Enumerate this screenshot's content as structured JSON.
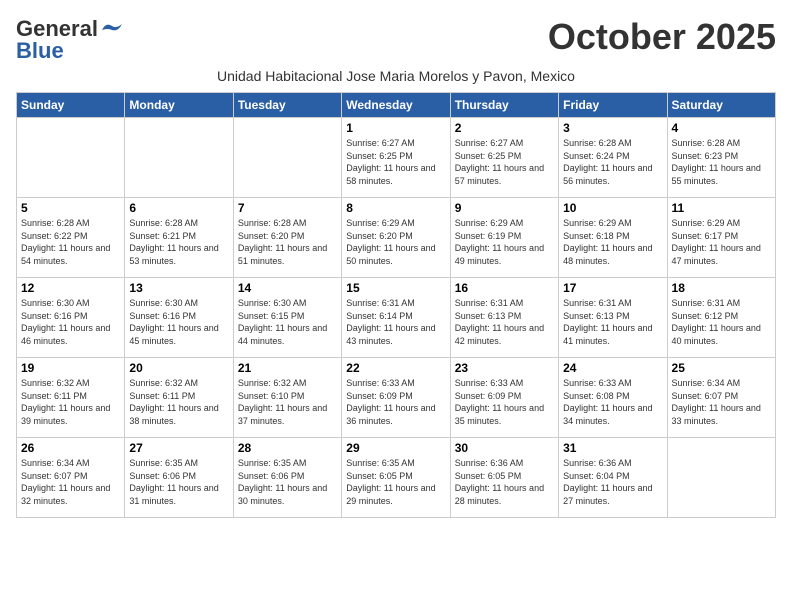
{
  "header": {
    "logo_general": "General",
    "logo_blue": "Blue",
    "month_title": "October 2025",
    "subtitle": "Unidad Habitacional Jose Maria Morelos y Pavon, Mexico"
  },
  "weekdays": [
    "Sunday",
    "Monday",
    "Tuesday",
    "Wednesday",
    "Thursday",
    "Friday",
    "Saturday"
  ],
  "weeks": [
    [
      {
        "day": "",
        "sunrise": "",
        "sunset": "",
        "daylight": ""
      },
      {
        "day": "",
        "sunrise": "",
        "sunset": "",
        "daylight": ""
      },
      {
        "day": "",
        "sunrise": "",
        "sunset": "",
        "daylight": ""
      },
      {
        "day": "1",
        "sunrise": "Sunrise: 6:27 AM",
        "sunset": "Sunset: 6:25 PM",
        "daylight": "Daylight: 11 hours and 58 minutes."
      },
      {
        "day": "2",
        "sunrise": "Sunrise: 6:27 AM",
        "sunset": "Sunset: 6:25 PM",
        "daylight": "Daylight: 11 hours and 57 minutes."
      },
      {
        "day": "3",
        "sunrise": "Sunrise: 6:28 AM",
        "sunset": "Sunset: 6:24 PM",
        "daylight": "Daylight: 11 hours and 56 minutes."
      },
      {
        "day": "4",
        "sunrise": "Sunrise: 6:28 AM",
        "sunset": "Sunset: 6:23 PM",
        "daylight": "Daylight: 11 hours and 55 minutes."
      }
    ],
    [
      {
        "day": "5",
        "sunrise": "Sunrise: 6:28 AM",
        "sunset": "Sunset: 6:22 PM",
        "daylight": "Daylight: 11 hours and 54 minutes."
      },
      {
        "day": "6",
        "sunrise": "Sunrise: 6:28 AM",
        "sunset": "Sunset: 6:21 PM",
        "daylight": "Daylight: 11 hours and 53 minutes."
      },
      {
        "day": "7",
        "sunrise": "Sunrise: 6:28 AM",
        "sunset": "Sunset: 6:20 PM",
        "daylight": "Daylight: 11 hours and 51 minutes."
      },
      {
        "day": "8",
        "sunrise": "Sunrise: 6:29 AM",
        "sunset": "Sunset: 6:20 PM",
        "daylight": "Daylight: 11 hours and 50 minutes."
      },
      {
        "day": "9",
        "sunrise": "Sunrise: 6:29 AM",
        "sunset": "Sunset: 6:19 PM",
        "daylight": "Daylight: 11 hours and 49 minutes."
      },
      {
        "day": "10",
        "sunrise": "Sunrise: 6:29 AM",
        "sunset": "Sunset: 6:18 PM",
        "daylight": "Daylight: 11 hours and 48 minutes."
      },
      {
        "day": "11",
        "sunrise": "Sunrise: 6:29 AM",
        "sunset": "Sunset: 6:17 PM",
        "daylight": "Daylight: 11 hours and 47 minutes."
      }
    ],
    [
      {
        "day": "12",
        "sunrise": "Sunrise: 6:30 AM",
        "sunset": "Sunset: 6:16 PM",
        "daylight": "Daylight: 11 hours and 46 minutes."
      },
      {
        "day": "13",
        "sunrise": "Sunrise: 6:30 AM",
        "sunset": "Sunset: 6:16 PM",
        "daylight": "Daylight: 11 hours and 45 minutes."
      },
      {
        "day": "14",
        "sunrise": "Sunrise: 6:30 AM",
        "sunset": "Sunset: 6:15 PM",
        "daylight": "Daylight: 11 hours and 44 minutes."
      },
      {
        "day": "15",
        "sunrise": "Sunrise: 6:31 AM",
        "sunset": "Sunset: 6:14 PM",
        "daylight": "Daylight: 11 hours and 43 minutes."
      },
      {
        "day": "16",
        "sunrise": "Sunrise: 6:31 AM",
        "sunset": "Sunset: 6:13 PM",
        "daylight": "Daylight: 11 hours and 42 minutes."
      },
      {
        "day": "17",
        "sunrise": "Sunrise: 6:31 AM",
        "sunset": "Sunset: 6:13 PM",
        "daylight": "Daylight: 11 hours and 41 minutes."
      },
      {
        "day": "18",
        "sunrise": "Sunrise: 6:31 AM",
        "sunset": "Sunset: 6:12 PM",
        "daylight": "Daylight: 11 hours and 40 minutes."
      }
    ],
    [
      {
        "day": "19",
        "sunrise": "Sunrise: 6:32 AM",
        "sunset": "Sunset: 6:11 PM",
        "daylight": "Daylight: 11 hours and 39 minutes."
      },
      {
        "day": "20",
        "sunrise": "Sunrise: 6:32 AM",
        "sunset": "Sunset: 6:11 PM",
        "daylight": "Daylight: 11 hours and 38 minutes."
      },
      {
        "day": "21",
        "sunrise": "Sunrise: 6:32 AM",
        "sunset": "Sunset: 6:10 PM",
        "daylight": "Daylight: 11 hours and 37 minutes."
      },
      {
        "day": "22",
        "sunrise": "Sunrise: 6:33 AM",
        "sunset": "Sunset: 6:09 PM",
        "daylight": "Daylight: 11 hours and 36 minutes."
      },
      {
        "day": "23",
        "sunrise": "Sunrise: 6:33 AM",
        "sunset": "Sunset: 6:09 PM",
        "daylight": "Daylight: 11 hours and 35 minutes."
      },
      {
        "day": "24",
        "sunrise": "Sunrise: 6:33 AM",
        "sunset": "Sunset: 6:08 PM",
        "daylight": "Daylight: 11 hours and 34 minutes."
      },
      {
        "day": "25",
        "sunrise": "Sunrise: 6:34 AM",
        "sunset": "Sunset: 6:07 PM",
        "daylight": "Daylight: 11 hours and 33 minutes."
      }
    ],
    [
      {
        "day": "26",
        "sunrise": "Sunrise: 6:34 AM",
        "sunset": "Sunset: 6:07 PM",
        "daylight": "Daylight: 11 hours and 32 minutes."
      },
      {
        "day": "27",
        "sunrise": "Sunrise: 6:35 AM",
        "sunset": "Sunset: 6:06 PM",
        "daylight": "Daylight: 11 hours and 31 minutes."
      },
      {
        "day": "28",
        "sunrise": "Sunrise: 6:35 AM",
        "sunset": "Sunset: 6:06 PM",
        "daylight": "Daylight: 11 hours and 30 minutes."
      },
      {
        "day": "29",
        "sunrise": "Sunrise: 6:35 AM",
        "sunset": "Sunset: 6:05 PM",
        "daylight": "Daylight: 11 hours and 29 minutes."
      },
      {
        "day": "30",
        "sunrise": "Sunrise: 6:36 AM",
        "sunset": "Sunset: 6:05 PM",
        "daylight": "Daylight: 11 hours and 28 minutes."
      },
      {
        "day": "31",
        "sunrise": "Sunrise: 6:36 AM",
        "sunset": "Sunset: 6:04 PM",
        "daylight": "Daylight: 11 hours and 27 minutes."
      },
      {
        "day": "",
        "sunrise": "",
        "sunset": "",
        "daylight": ""
      }
    ]
  ]
}
